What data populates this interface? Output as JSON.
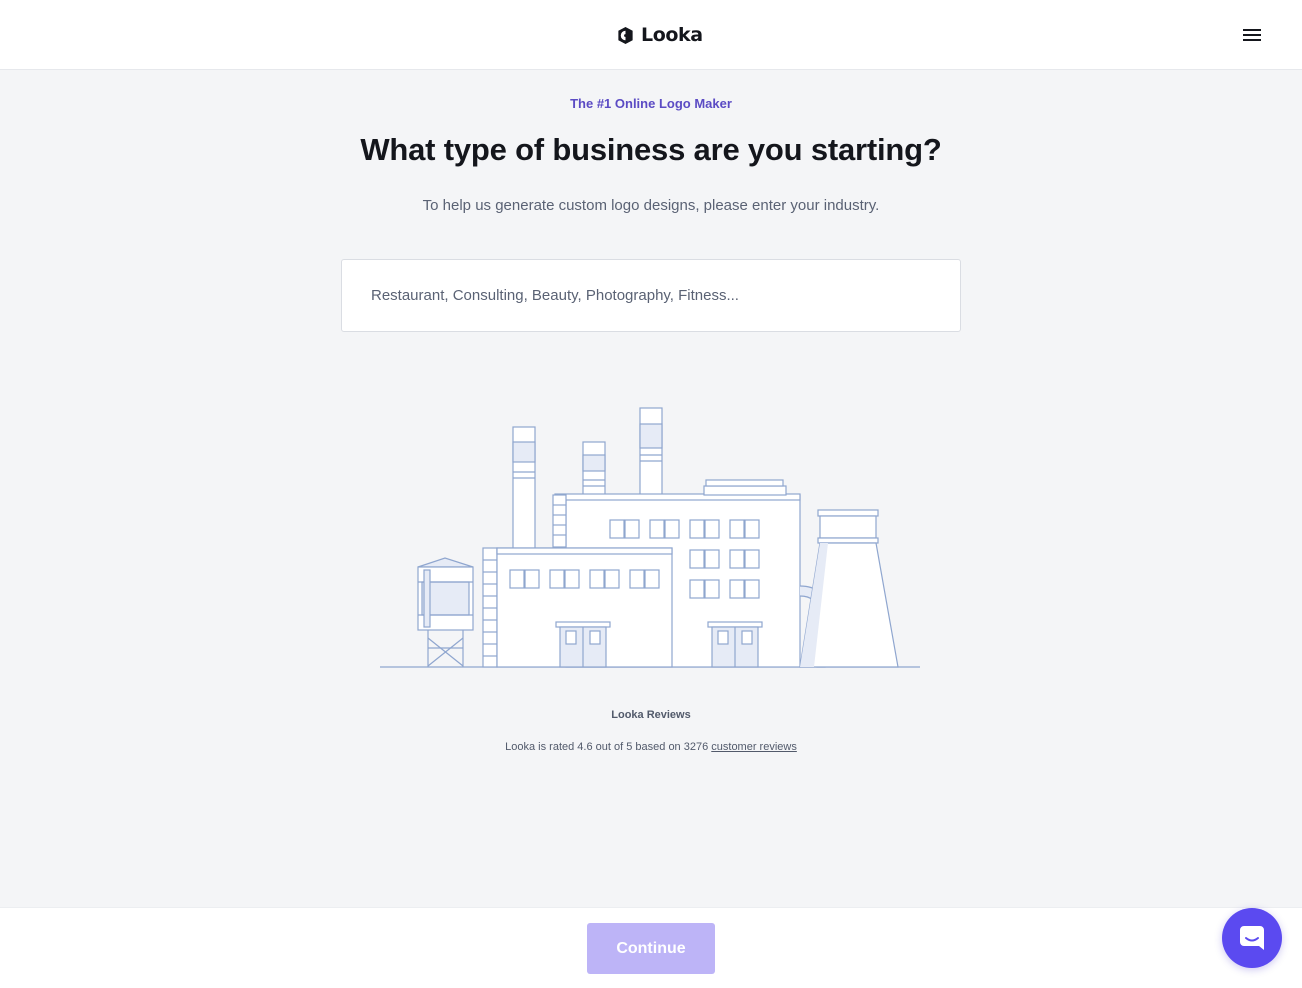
{
  "header": {
    "brand_name": "Looka",
    "brand_icon": "looka-logo-mark",
    "menu_icon": "hamburger-menu-icon"
  },
  "main": {
    "eyebrow": "The #1 Online Logo Maker",
    "title": "What type of business are you starting?",
    "subtitle": "To help us generate custom logo designs, please enter your industry.",
    "industry_input": {
      "value": "",
      "placeholder": "Restaurant, Consulting, Beauty, Photography, Fitness..."
    },
    "illustration_name": "factory-illustration"
  },
  "reviews": {
    "title": "Looka Reviews",
    "text_prefix": "Looka is rated 4.6 out of 5 based on 3276",
    "link_text": "customer reviews",
    "rating": 4.6,
    "rating_max": 5,
    "review_count": 3276
  },
  "footer": {
    "continue_label": "Continue",
    "continue_enabled": false
  },
  "chat": {
    "icon": "chat-bubble-icon"
  },
  "colors": {
    "accent": "#5b4bc4",
    "chat_button": "#5b4af0",
    "continue_disabled": "#bdb4f7",
    "background": "#f4f5f7",
    "illustration_stroke": "#8fa6cf",
    "illustration_fill": "#e6ebf6"
  }
}
